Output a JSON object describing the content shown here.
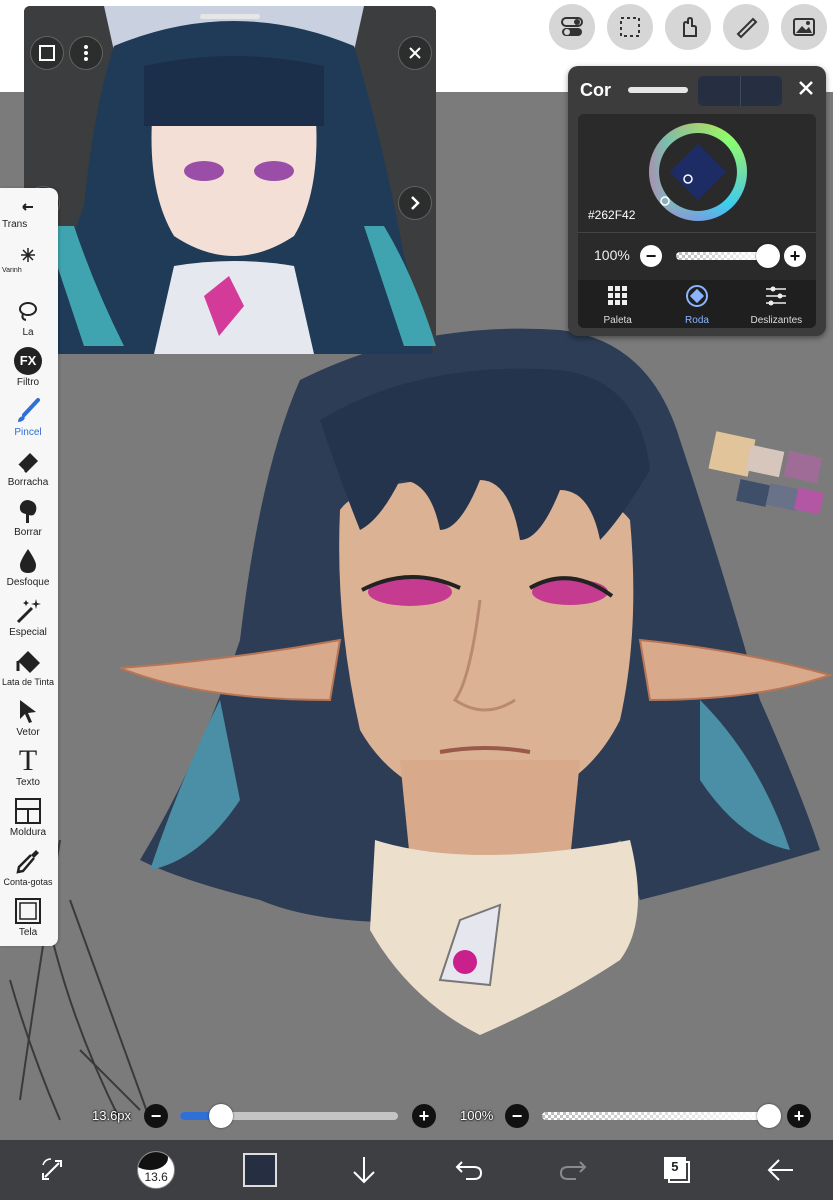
{
  "reference": {
    "prev_icon": "chevron-left-icon",
    "next_icon": "chevron-right-icon",
    "close_icon": "close-icon"
  },
  "toolbar": {
    "items": [
      {
        "label": "Trans",
        "icon": "transform-icon"
      },
      {
        "label": "Varinh",
        "icon": "magic-wand-icon"
      },
      {
        "label": "La",
        "icon": "lasso-icon"
      },
      {
        "label": "Filtro",
        "icon": "fx-icon"
      },
      {
        "label": "Pincel",
        "icon": "brush-icon",
        "active": true
      },
      {
        "label": "Borracha",
        "icon": "eraser-icon"
      },
      {
        "label": "Borrar",
        "icon": "smudge-icon"
      },
      {
        "label": "Desfoque",
        "icon": "blur-drop-icon"
      },
      {
        "label": "Especial",
        "icon": "special-brush-icon"
      },
      {
        "label": "Lata de Tinta",
        "icon": "paint-bucket-icon"
      },
      {
        "label": "Vetor",
        "icon": "vector-pointer-icon"
      },
      {
        "label": "Texto",
        "icon": "text-icon"
      },
      {
        "label": "Moldura",
        "icon": "frame-icon"
      },
      {
        "label": "Conta-gotas",
        "icon": "eyedropper-icon"
      },
      {
        "label": "Tela",
        "icon": "canvas-icon"
      }
    ],
    "fx_glyph": "FX",
    "text_glyph": "T"
  },
  "color_panel": {
    "title": "Cor",
    "hex": "#262F42",
    "current_color": "#262F42",
    "opacity": "100%",
    "tabs": [
      {
        "label": "Paleta",
        "icon": "palette-grid-icon"
      },
      {
        "label": "Roda",
        "icon": "color-wheel-icon",
        "active": true
      },
      {
        "label": "Deslizantes",
        "icon": "sliders-icon"
      }
    ]
  },
  "sliders": {
    "brush_size": "13.6px",
    "brush_size_fraction": 0.17,
    "opacity": "100%",
    "opacity_fraction": 1.0
  },
  "bottom_bar": {
    "brush_size_badge": "13.6",
    "layer_count": "5"
  },
  "colors": {
    "accent": "#2f6fd6",
    "panel_bg": "#3c3c3c",
    "canvas_bg": "#7b7b7b"
  }
}
